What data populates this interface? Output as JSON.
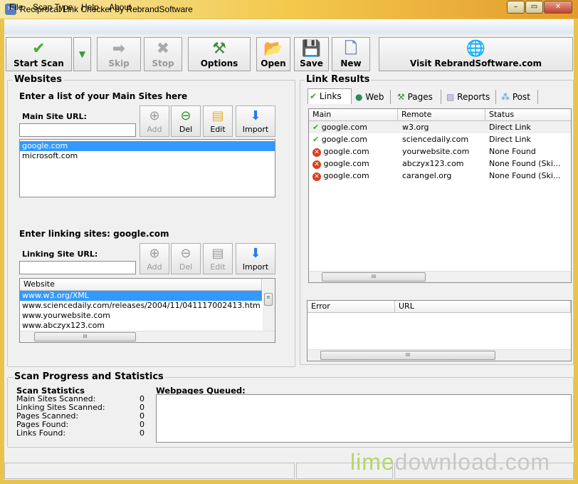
{
  "window": {
    "title": "Reciprocal Link Checker by RebrandSoftware"
  },
  "menu": [
    "File",
    "Scan Type",
    "Help",
    "About"
  ],
  "toolbar": {
    "start": "Start Scan",
    "skip": "Skip",
    "stop": "Stop",
    "options": "Options",
    "open": "Open",
    "save": "Save",
    "new": "New",
    "visit": "Visit RebrandSoftware.com"
  },
  "websites": {
    "title": "Websites",
    "instruction": "Enter a list of your Main Sites here",
    "main_label": "Main Site URL:",
    "main_value": "",
    "buttons": [
      "Add",
      "Del",
      "Edit",
      "Import"
    ],
    "main_sites": [
      "google.com",
      "microsoft.com"
    ],
    "linking_heading": "Enter linking sites: google.com",
    "linking_label": "Linking Site URL:",
    "linking_value": "",
    "linking_buttons": [
      "Add",
      "Del",
      "Edit",
      "Import"
    ],
    "linking_header": "Website",
    "linking_sites": [
      "www.w3.org/XML",
      "www.sciencedaily.com/releases/2004/11/041117002413.htm",
      "www.yourwebsite.com",
      "www.abczyx123.com"
    ]
  },
  "results": {
    "title": "Link Results",
    "tabs": [
      "Links",
      "Web",
      "Pages",
      "Reports",
      "Post"
    ],
    "columns": [
      "Main",
      "Remote",
      "Status"
    ],
    "rows": [
      {
        "ok": true,
        "main": "google.com",
        "remote": "w3.org",
        "status": "Direct Link"
      },
      {
        "ok": true,
        "main": "google.com",
        "remote": "sciencedaily.com",
        "status": "Direct Link"
      },
      {
        "ok": false,
        "main": "google.com",
        "remote": "yourwebsite.com",
        "status": "None Found"
      },
      {
        "ok": false,
        "main": "google.com",
        "remote": "abczyx123.com",
        "status": "None Found (Ski..."
      },
      {
        "ok": false,
        "main": "google.com",
        "remote": "carangel.org",
        "status": "None Found (Ski..."
      }
    ],
    "error_columns": [
      "Error",
      "URL"
    ]
  },
  "progress": {
    "title": "Scan Progress and Statistics",
    "stats_title": "Scan Statistics",
    "stats": [
      {
        "label": "Main Sites Scanned:",
        "value": "0"
      },
      {
        "label": "Linking Sites Scanned:",
        "value": "0"
      },
      {
        "label": "Pages Scanned:",
        "value": "0"
      },
      {
        "label": "Pages Found:",
        "value": "0"
      },
      {
        "label": "Links Found:",
        "value": "0"
      }
    ],
    "queued_label": "Webpages Queued:"
  },
  "watermark": {
    "a": "lime",
    "b": "download.com"
  }
}
